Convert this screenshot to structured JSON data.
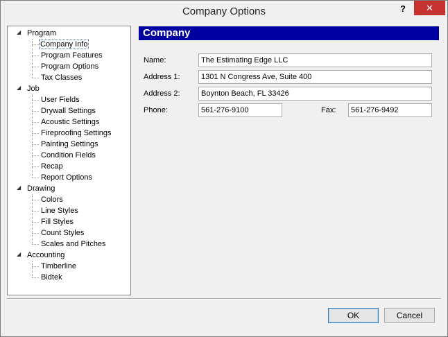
{
  "window": {
    "title": "Company Options",
    "help_label": "?",
    "close_label": "✕"
  },
  "tree": {
    "groups": [
      {
        "label": "Program",
        "items": [
          "Company Info",
          "Program Features",
          "Program Options",
          "Tax Classes"
        ]
      },
      {
        "label": "Job",
        "items": [
          "User Fields",
          "Drywall Settings",
          "Acoustic Settings",
          "Fireproofing Settings",
          "Painting Settings",
          "Condition Fields",
          "Recap",
          "Report Options"
        ]
      },
      {
        "label": "Drawing",
        "items": [
          "Colors",
          "Line Styles",
          "Fill Styles",
          "Count Styles",
          "Scales and Pitches"
        ]
      },
      {
        "label": "Accounting",
        "items": [
          "Timberline",
          "Bidtek"
        ]
      }
    ],
    "selected": "Company Info"
  },
  "panel": {
    "header": "Company",
    "name_label": "Name:",
    "name_value": "The Estimating Edge LLC",
    "address1_label": "Address 1:",
    "address1_value": "1301 N Congress Ave, Suite 400",
    "address2_label": "Address 2:",
    "address2_value": "Boynton Beach, FL 33426",
    "phone_label": "Phone:",
    "phone_value": "561-276-9100",
    "fax_label": "Fax:",
    "fax_value": "561-276-9492"
  },
  "buttons": {
    "ok": "OK",
    "cancel": "Cancel"
  }
}
